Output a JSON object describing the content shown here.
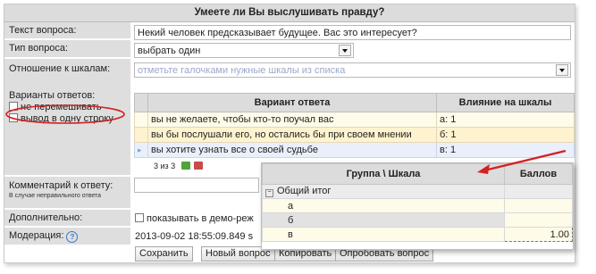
{
  "title": "Умеете ли Вы выслушивать правду?",
  "labels": {
    "question_text": "Текст вопроса:",
    "question_type": "Тип вопроса:",
    "scales_relation": "Отношение к шкалам:",
    "answer_options": "Варианты ответов:",
    "comment": "Комментарий к ответу:",
    "comment_hint": "В случае неправильного ответа",
    "additional": "Дополнительно:",
    "moderation": "Модерация:"
  },
  "fields": {
    "question_text_value": "Некий человек предсказывает будущее. Вас это интересует?",
    "question_type_value": "выбрать один",
    "scales_placeholder": "отметьте галочками нужные шкалы из списка",
    "show_demo": "показывать в демо-реж",
    "moderation_value": "2013-09-02 18:55:09.849 s"
  },
  "options": {
    "no_shuffle": "не перемешивать",
    "one_line": "вывод в одну строку"
  },
  "answers_grid": {
    "col_answer": "Вариант ответа",
    "col_influence": "Влияние на шкалы",
    "rows": [
      {
        "answer": "вы не желаете, чтобы кто-то поучал вас",
        "influence": "а: 1"
      },
      {
        "answer": "вы бы послушали его, но остались бы при своем мнении",
        "influence": "б: 1"
      },
      {
        "answer": "вы хотите узнать все о своей судьбе",
        "influence": "в: 1"
      }
    ],
    "pager": "3 из 3"
  },
  "popup": {
    "col_group": "Группа \\ Шкала",
    "col_points": "Баллов",
    "group_total": "Общий итог",
    "rows": [
      {
        "name": "а",
        "value": ""
      },
      {
        "name": "б",
        "value": ""
      },
      {
        "name": "в",
        "value": "1.00"
      }
    ]
  },
  "buttons": {
    "save": "Сохранить",
    "new_question": "Новый вопрос",
    "copy": "Копировать",
    "try_question": "Опробовать вопрос"
  },
  "colors": {
    "annotation_red": "#d42020"
  }
}
